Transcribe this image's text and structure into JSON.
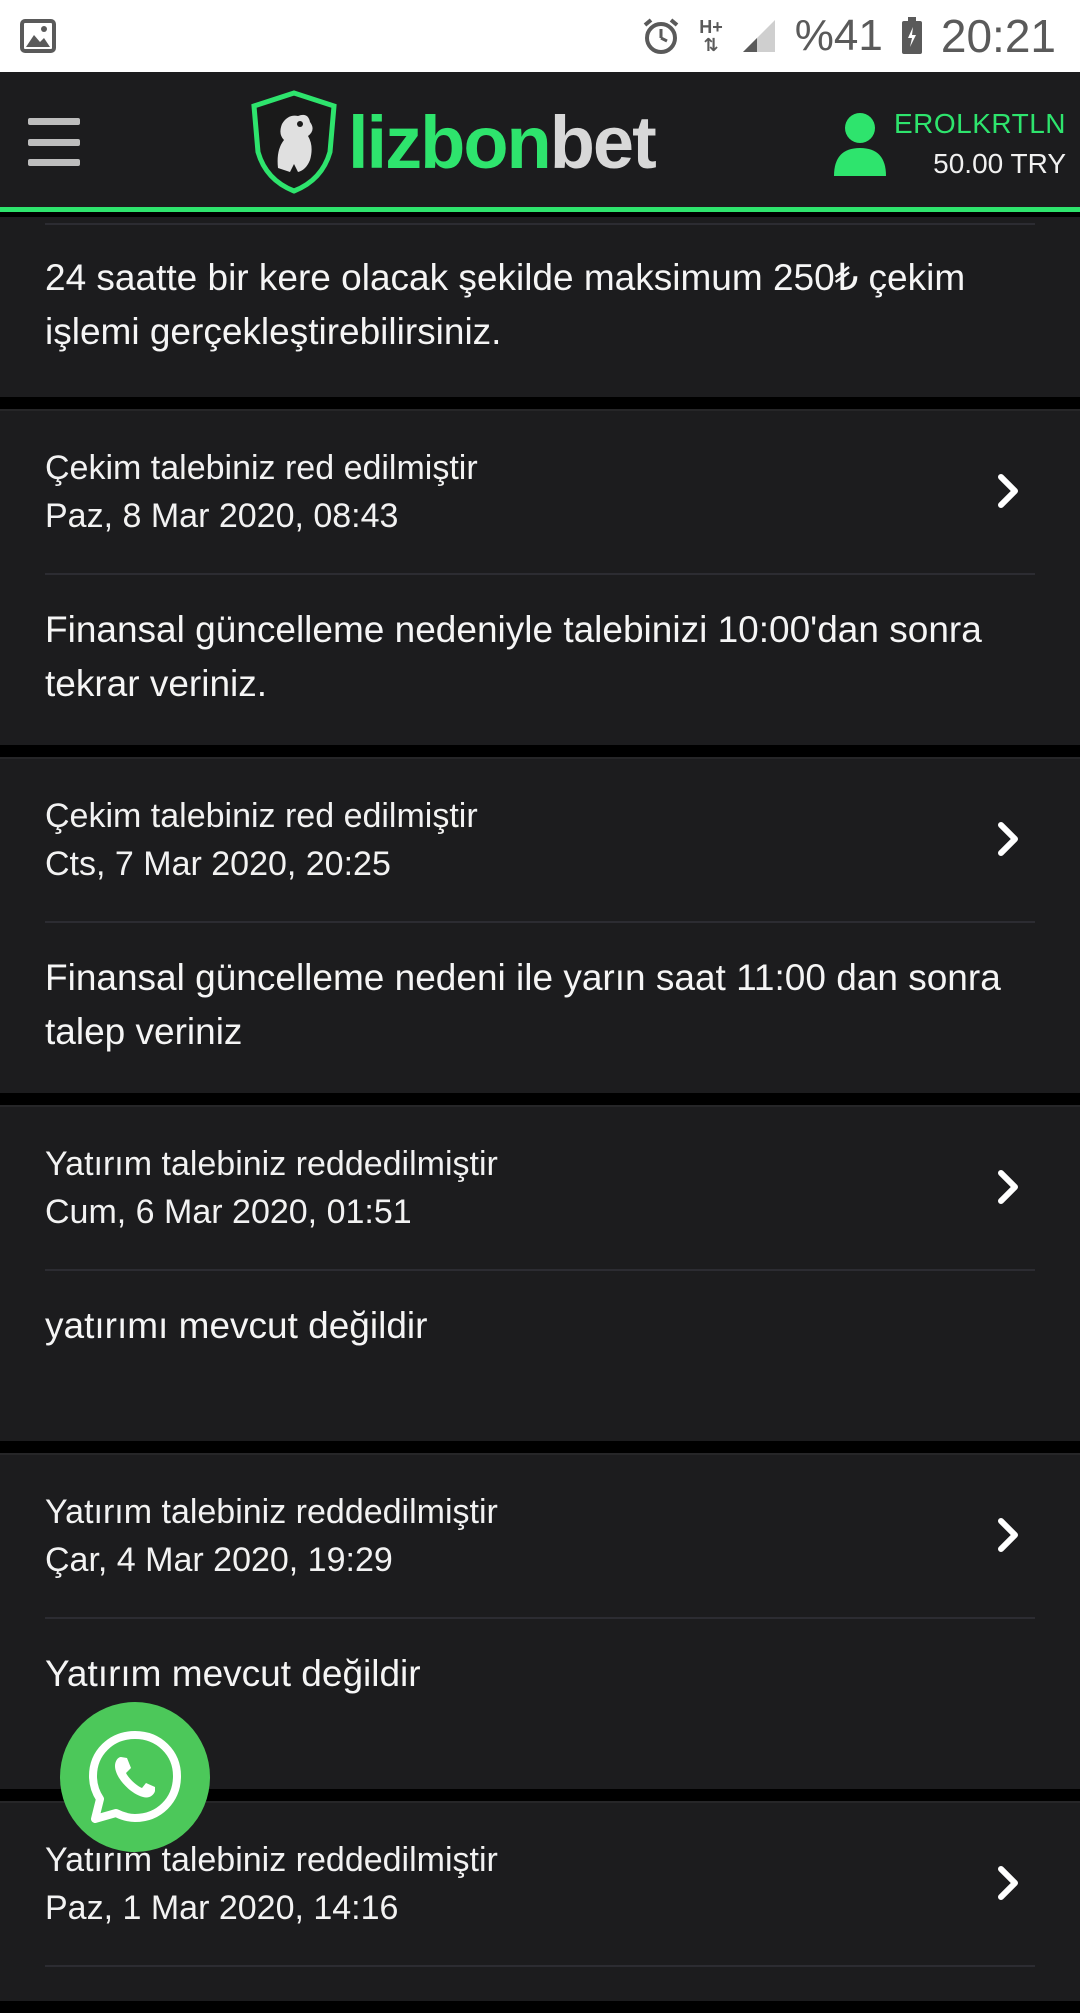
{
  "status_bar": {
    "battery_text": "%41",
    "time": "20:21",
    "network_label": "H+"
  },
  "header": {
    "logo_part1": "lizbon",
    "logo_part2": "bet",
    "username": "EROLKRTLN",
    "balance": "50.00 TRY"
  },
  "colors": {
    "accent": "#2ee46d",
    "card_bg": "#1c1c1e",
    "page_bg": "#000000",
    "whatsapp": "#4cc85a"
  },
  "info_text": "24 saatte bir kere olacak şekilde maksimum 250₺ çekim işlemi gerçekleştirebilirsiniz.",
  "notifications": [
    {
      "title": "Çekim talebiniz red edilmiştir",
      "date": "Paz, 8 Mar 2020, 08:43",
      "message": "Finansal güncelleme nedeniyle talebinizi 10:00'dan sonra tekrar veriniz."
    },
    {
      "title": "Çekim talebiniz red edilmiştir",
      "date": "Cts, 7 Mar 2020, 20:25",
      "message": "Finansal güncelleme nedeni ile yarın saat 11:00 dan sonra talep veriniz"
    },
    {
      "title": "Yatırım talebiniz reddedilmiştir",
      "date": "Cum, 6 Mar 2020, 01:51",
      "message": "yatırımı mevcut değildir"
    },
    {
      "title": "Yatırım talebiniz reddedilmiştir",
      "date": "Çar, 4 Mar 2020, 19:29",
      "message": "Yatırım mevcut değildir"
    },
    {
      "title": "Yatırım talebiniz reddedilmiştir",
      "date": "Paz, 1 Mar 2020, 14:16",
      "message": ""
    }
  ]
}
